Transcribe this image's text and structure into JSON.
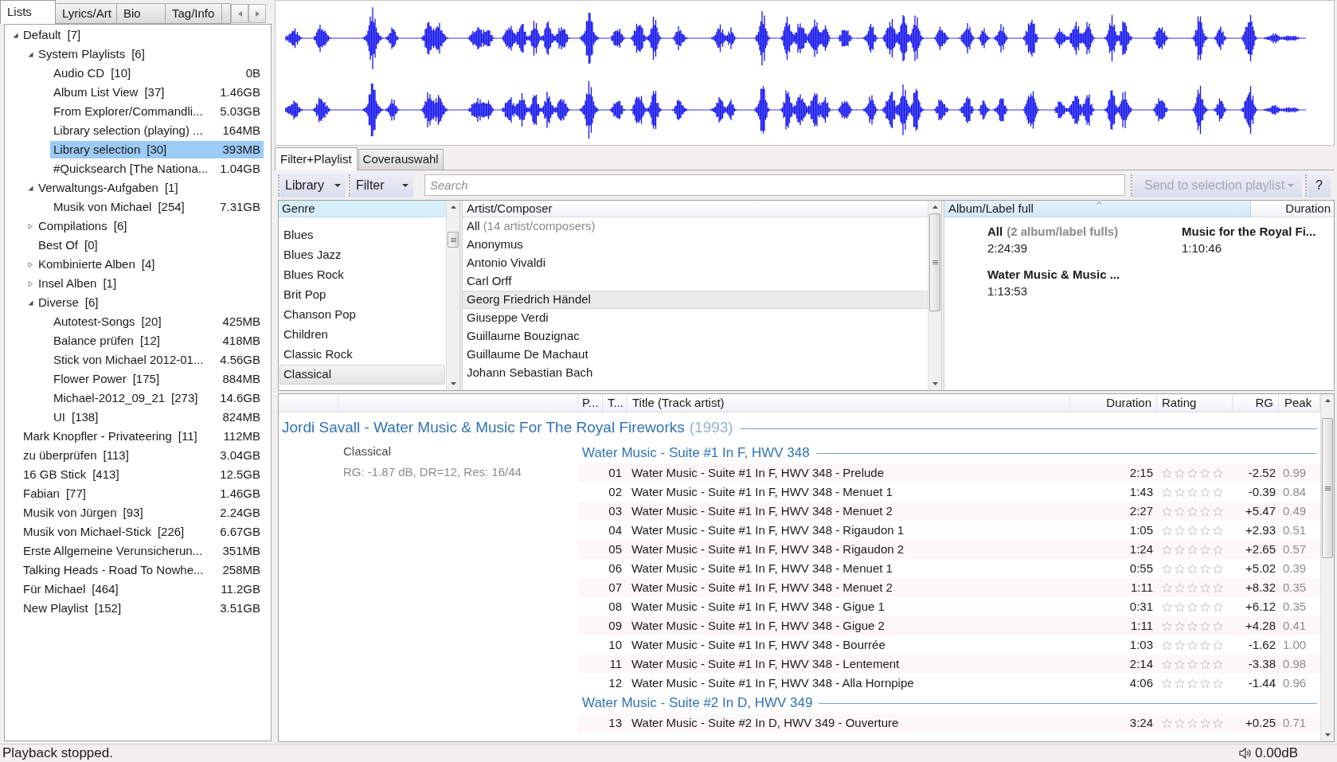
{
  "left_tabs": [
    {
      "label": "Lists",
      "selected": true
    },
    {
      "label": "Lyrics/Art",
      "selected": false
    },
    {
      "label": "Bio",
      "selected": false
    },
    {
      "label": "Tag/Info",
      "selected": false
    }
  ],
  "playlists": [
    {
      "name": "Default",
      "count": "[7]",
      "expanded": true,
      "selected": false,
      "children": [
        {
          "name": "System Playlists",
          "count": "[6]",
          "expanded": true,
          "selected": false,
          "children": [
            {
              "name": "Audio CD",
              "count": "[10]",
              "size": "0B",
              "selected": false
            },
            {
              "name": "Album List View",
              "count": "[37]",
              "size": "1.46GB",
              "selected": false
            },
            {
              "name": "From Explorer/Commandli...",
              "size": "5.03GB",
              "selected": false
            },
            {
              "name": "Library selection (playing) ...",
              "size": "164MB",
              "selected": false
            },
            {
              "name": "Library selection",
              "count": "[30]",
              "size": "393MB",
              "selected": true
            },
            {
              "name": "#Quicksearch [The Nationa...",
              "size": "1.04GB",
              "selected": false
            }
          ]
        },
        {
          "name": "Verwaltungs-Aufgaben",
          "count": "[1]",
          "expanded": true,
          "selected": false,
          "children": [
            {
              "name": "Musik von Michael",
              "count": "[254]",
              "size": "7.31GB",
              "selected": false
            }
          ]
        },
        {
          "name": "Compilations",
          "count": "[6]",
          "expanded": false,
          "selected": false
        },
        {
          "name": "Best Of",
          "count": "[0]",
          "selected": false
        },
        {
          "name": "Kombinierte Alben",
          "count": "[4]",
          "expanded": false,
          "selected": false
        },
        {
          "name": "Insel Alben",
          "count": "[1]",
          "expanded": false,
          "selected": false
        },
        {
          "name": "Diverse",
          "count": "[6]",
          "expanded": true,
          "selected": false,
          "children": [
            {
              "name": "Autotest-Songs",
              "count": "[20]",
              "size": "425MB",
              "selected": false
            },
            {
              "name": "Balance prüfen",
              "count": "[12]",
              "size": "418MB",
              "selected": false
            },
            {
              "name": "Stick von Michael 2012-01...",
              "size": "4.56GB",
              "selected": false
            },
            {
              "name": "Flower Power",
              "count": "[175]",
              "size": "884MB",
              "selected": false
            },
            {
              "name": "Michael-2012_09_21",
              "count": "[273]",
              "size": "14.6GB",
              "selected": false
            },
            {
              "name": "UI",
              "count": "[138]",
              "size": "824MB",
              "selected": false
            }
          ]
        }
      ]
    },
    {
      "name": "Mark Knopfler - Privateering",
      "count": "[11]",
      "size": "112MB",
      "selected": false
    },
    {
      "name": "zu überprüfen",
      "count": "[113]",
      "size": "3.04GB",
      "selected": false
    },
    {
      "name": "16 GB Stick",
      "count": "[413]",
      "size": "12.5GB",
      "selected": false
    },
    {
      "name": "Fabian",
      "count": "[77]",
      "size": "1.46GB",
      "selected": false
    },
    {
      "name": "Musik von Jürgen",
      "count": "[93]",
      "size": "2.24GB",
      "selected": false
    },
    {
      "name": "Musik von Michael-Stick",
      "count": "[226]",
      "size": "6.67GB",
      "selected": false
    },
    {
      "name": "Erste Allgemeine Verunsicherun...",
      "size": "351MB",
      "selected": false
    },
    {
      "name": "Talking Heads - Road To Nowhe...",
      "size": "258MB",
      "selected": false
    },
    {
      "name": "Für Michael",
      "count": "[464]",
      "size": "11.2GB",
      "selected": false
    },
    {
      "name": "New Playlist",
      "count": "[152]",
      "size": "3.51GB",
      "selected": false
    }
  ],
  "main_tabs": [
    {
      "label": "Filter+Playlist",
      "selected": true
    },
    {
      "label": "Coverauswahl",
      "selected": false
    }
  ],
  "toolbar": {
    "library_button": "Library",
    "filter_button": "Filter",
    "search": {
      "placeholder": "Search"
    },
    "send_button": {
      "label": "Send to selection playlist",
      "disabled": true
    },
    "help_button": "?"
  },
  "genre_pane": {
    "header": "Genre",
    "items": [
      {
        "label": "Blues",
        "selected": false
      },
      {
        "label": "Blues Jazz",
        "selected": false
      },
      {
        "label": "Blues Rock",
        "selected": false
      },
      {
        "label": "Brit Pop",
        "selected": false
      },
      {
        "label": "Chanson Pop",
        "selected": false
      },
      {
        "label": "Children",
        "selected": false
      },
      {
        "label": "Classic Rock",
        "selected": false
      },
      {
        "label": "Classical",
        "selected": true
      }
    ]
  },
  "artist_pane": {
    "header": "Artist/Composer",
    "items": [
      {
        "label": "All",
        "note": "(14 artist/composers)",
        "selected": false
      },
      {
        "label": "Anonymus",
        "selected": false
      },
      {
        "label": "Antonio Vivaldi",
        "selected": false
      },
      {
        "label": "Carl Orff",
        "selected": false
      },
      {
        "label": "Georg Friedrich Händel",
        "selected": true
      },
      {
        "label": "Giuseppe Verdi",
        "selected": false
      },
      {
        "label": "Guillaume Bouzignac",
        "selected": false
      },
      {
        "label": "Guillaume De Machaut",
        "selected": false
      },
      {
        "label": "Johann Sebastian Bach",
        "selected": false
      }
    ]
  },
  "album_pane": {
    "columns": [
      "Album/Label full",
      "Duration"
    ],
    "items": [
      {
        "title": "All",
        "note": "(2 album/label fulls)",
        "duration": "2:24:39"
      },
      {
        "title": "Music for the Royal Fi...",
        "duration": "1:10:46"
      },
      {
        "title": "Water Music & Music ...",
        "duration": "1:13:53"
      }
    ]
  },
  "playlist": {
    "columns": [
      "P...",
      "T...",
      "Title (Track artist)",
      "Duration",
      "Rating",
      "RG",
      "Peak"
    ],
    "album": {
      "title": "Jordi Savall - Water Music & Music For The Royal Fireworks",
      "year": "(1993)",
      "genre": "Classical",
      "info": "RG: -1.87 dB, DR=12, Res: 16/44"
    },
    "groups": [
      {
        "title": "Water Music - Suite #1 In F, HWV 348",
        "tracks": [
          {
            "number": "01",
            "title": "Water Music - Suite #1 In F, HWV 348 - Prelude",
            "duration": "2:15",
            "stars": 0,
            "rg": "-2.52",
            "peak": "0.99"
          },
          {
            "number": "02",
            "title": "Water Music - Suite #1 In F, HWV 348 - Menuet 1",
            "duration": "1:43",
            "stars": 0,
            "rg": "-0.39",
            "peak": "0.84"
          },
          {
            "number": "03",
            "title": "Water Music - Suite #1 In F, HWV 348 - Menuet 2",
            "duration": "2:27",
            "stars": 0,
            "rg": "+5.47",
            "peak": "0.49"
          },
          {
            "number": "04",
            "title": "Water Music - Suite #1 In F, HWV 348 - Rigaudon 1",
            "duration": "1:05",
            "stars": 0,
            "rg": "+2.93",
            "peak": "0.51"
          },
          {
            "number": "05",
            "title": "Water Music - Suite #1 In F, HWV 348 - Rigaudon 2",
            "duration": "1:24",
            "stars": 0,
            "rg": "+2.65",
            "peak": "0.57"
          },
          {
            "number": "06",
            "title": "Water Music - Suite #1 In F, HWV 348 - Menuet 1",
            "duration": "0:55",
            "stars": 0,
            "rg": "+5.02",
            "peak": "0.39"
          },
          {
            "number": "07",
            "title": "Water Music - Suite #1 In F, HWV 348 - Menuet 2",
            "duration": "1:11",
            "stars": 0,
            "rg": "+8.32",
            "peak": "0.35"
          },
          {
            "number": "08",
            "title": "Water Music - Suite #1 In F, HWV 348 - Gigue 1",
            "duration": "0:31",
            "stars": 0,
            "rg": "+6.12",
            "peak": "0.35"
          },
          {
            "number": "09",
            "title": "Water Music - Suite #1 In F, HWV 348 - Gigue 2",
            "duration": "1:11",
            "stars": 0,
            "rg": "+4.28",
            "peak": "0.41"
          },
          {
            "number": "10",
            "title": "Water Music - Suite #1 In F, HWV 348 - Bourrée",
            "duration": "1:03",
            "stars": 0,
            "rg": "-1.62",
            "peak": "1.00"
          },
          {
            "number": "11",
            "title": "Water Music - Suite #1 In F, HWV 348 - Lentement",
            "duration": "2:14",
            "stars": 0,
            "rg": "-3.38",
            "peak": "0.98"
          },
          {
            "number": "12",
            "title": "Water Music - Suite #1 In F, HWV 348 - Alla Hornpipe",
            "duration": "4:06",
            "stars": 0,
            "rg": "-1.44",
            "peak": "0.96"
          }
        ]
      },
      {
        "title": "Water Music - Suite #2 In D, HWV 349",
        "tracks": [
          {
            "number": "13",
            "title": "Water Music - Suite #2 In D, HWV 349 - Ouverture",
            "duration": "3:24",
            "stars": 0,
            "rg": "+0.25",
            "peak": "0.71"
          }
        ]
      }
    ]
  },
  "status_bar": {
    "message": "Playback stopped.",
    "volume": "0.00dB"
  }
}
